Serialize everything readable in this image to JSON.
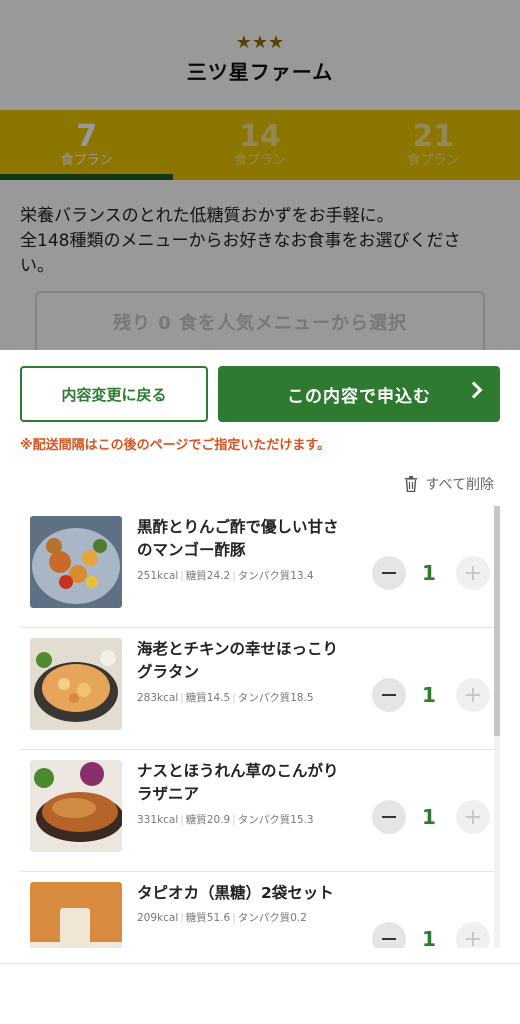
{
  "brand": {
    "stars": "★★★",
    "name": "三ツ星ファーム"
  },
  "plans": [
    {
      "number": "7",
      "unit": "食プラン",
      "active": true
    },
    {
      "number": "14",
      "unit": "食プラン",
      "active": false
    },
    {
      "number": "21",
      "unit": "食プラン",
      "active": false
    }
  ],
  "intro": {
    "line1": "栄養バランスのとれた低糖質おかずをお手軽に。",
    "line2": "全148種類のメニューからお好きなお食事をお選びくださ",
    "line3": "い。"
  },
  "random_button": "残り 0 食を人気メニューから選択",
  "sheet": {
    "back_label": "内容変更に戻る",
    "submit_label": "この内容で申込む",
    "notice": "※配送間隔はこの後のページでご指定いただけます。",
    "delete_all": "すべて削除"
  },
  "items": [
    {
      "name1": "黒酢とりんご酢で優しい甘さ",
      "name2": "のマンゴー酢豚",
      "kcal": "251kcal",
      "carb": "糖質24.2",
      "protein": "タンパク質13.4",
      "qty": "1"
    },
    {
      "name1": "海老とチキンの幸せほっこり",
      "name2": "グラタン",
      "kcal": "283kcal",
      "carb": "糖質14.5",
      "protein": "タンパク質18.5",
      "qty": "1"
    },
    {
      "name1": "ナスとほうれん草のこんがり",
      "name2": "ラザニア",
      "kcal": "331kcal",
      "carb": "糖質20.9",
      "protein": "タンパク質15.3",
      "qty": "1"
    },
    {
      "name1": "タピオカ（黒糖）2袋セット",
      "name2": "",
      "kcal": "209kcal",
      "carb": "糖質51.6",
      "protein": "タンパク質0.2",
      "qty": "1"
    }
  ],
  "colors": {
    "primary": "#2f7a31",
    "plan_bar": "#e9c300",
    "notice": "#d6541f"
  }
}
